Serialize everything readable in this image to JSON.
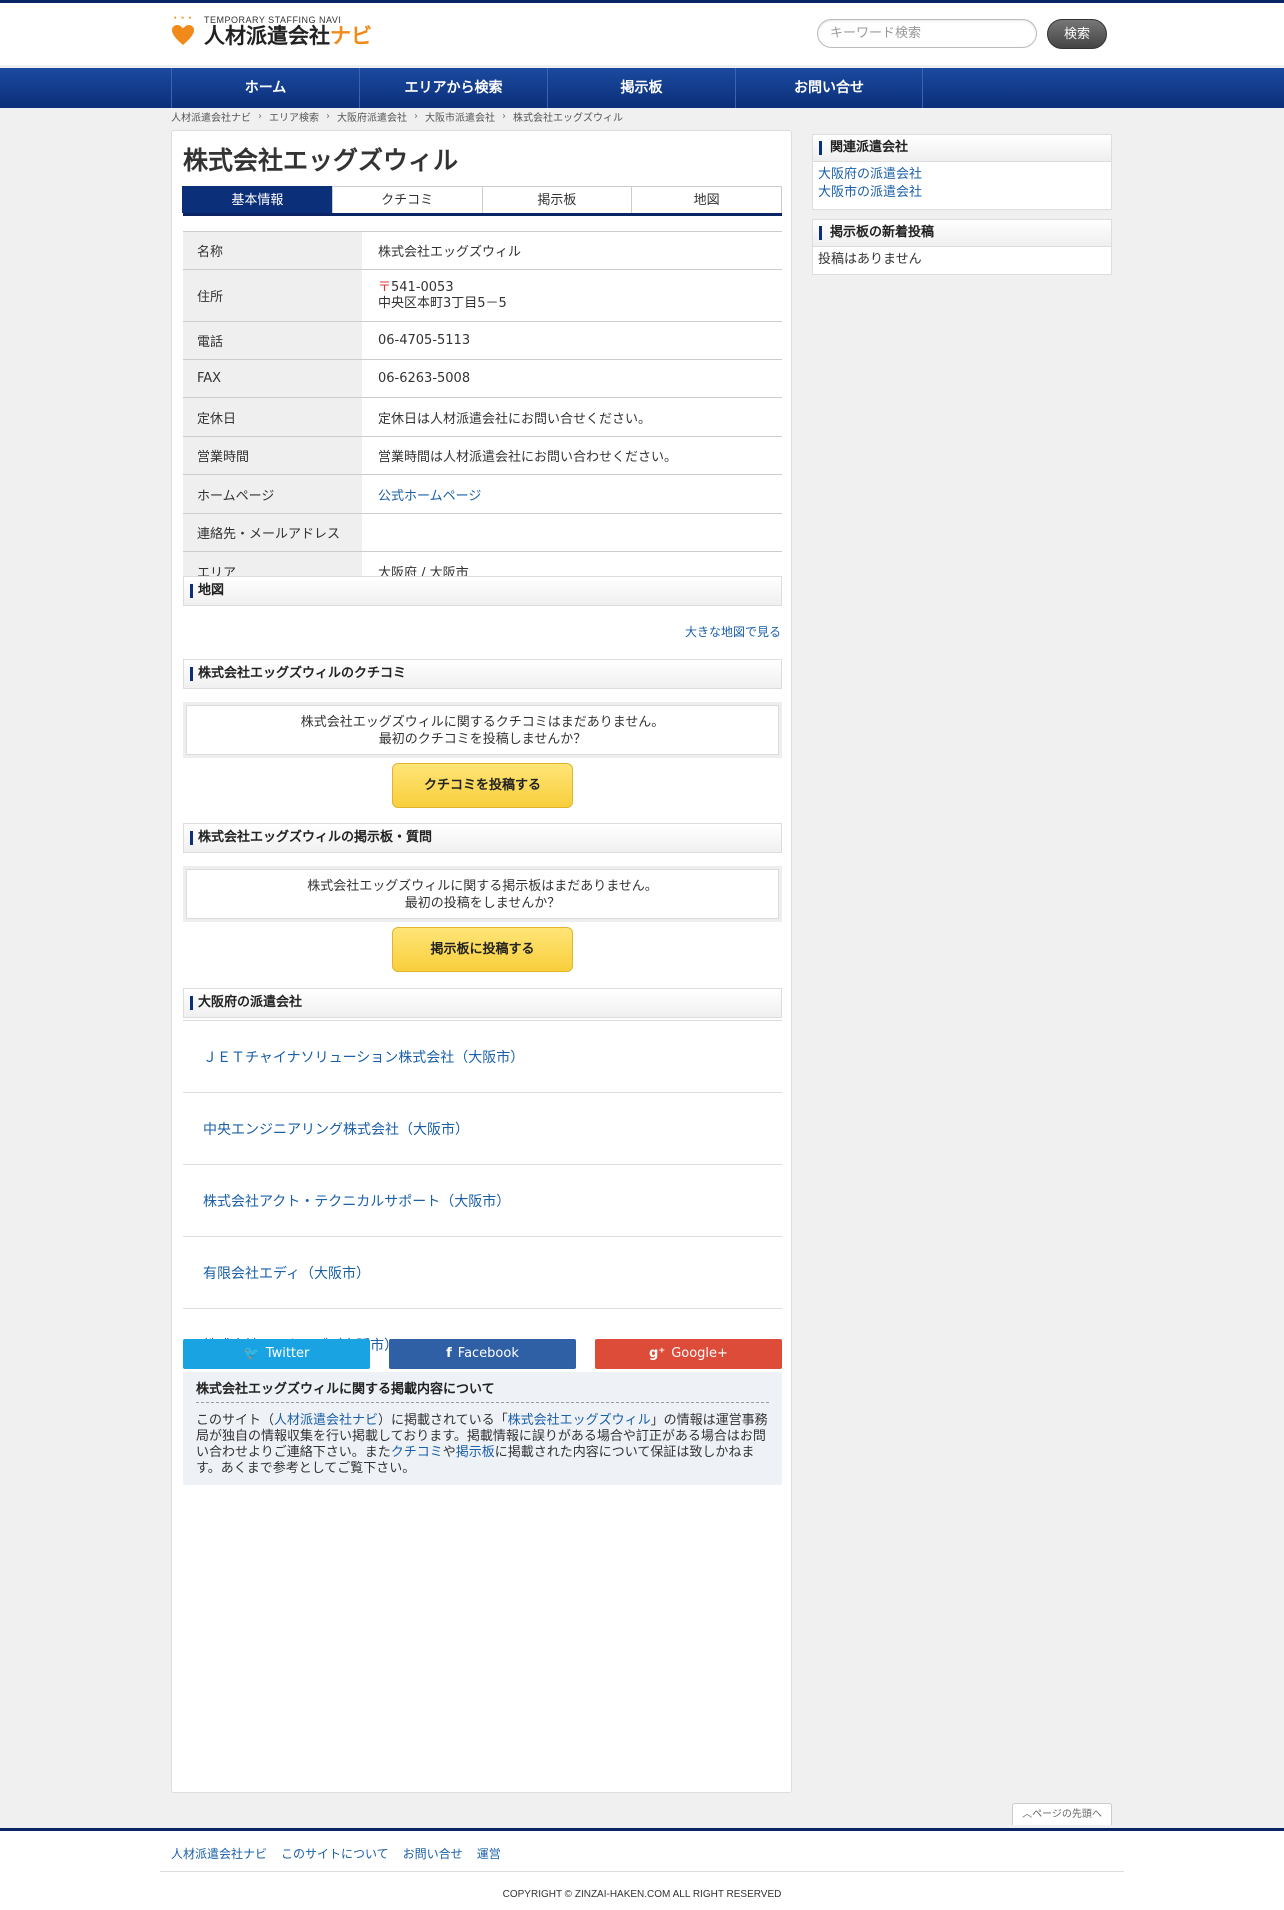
{
  "header": {
    "logo_sub": "TEMPORARY STAFFING NAVI",
    "logo_main": "人材派遣会社",
    "logo_accent": "ナビ",
    "search_placeholder": "キーワード検索",
    "search_button": "検索"
  },
  "nav": [
    "ホーム",
    "エリアから検索",
    "掲示板",
    "お問い合せ"
  ],
  "breadcrumb": [
    "人材派遣会社ナビ",
    "エリア検索",
    "大阪府派遣会社",
    "大阪市派遣会社",
    "株式会社エッグズウィル"
  ],
  "company": {
    "name": "株式会社エッグズウィル",
    "tabs": [
      "基本情報",
      "クチコミ",
      "掲示板",
      "地図"
    ],
    "info": {
      "name_label": "名称",
      "name_value": "株式会社エッグズウィル",
      "address_label": "住所",
      "postal": "〒541-0053",
      "address": "中央区本町3丁目5－5",
      "phone_label": "電話",
      "phone": "06-4705-5113",
      "fax_label": "FAX",
      "fax": "06-6263-5008",
      "holiday_label": "定休日",
      "holiday": "定休日は人材派遣会社にお問い合せください。",
      "hours_label": "営業時間",
      "hours": "営業時間は人材派遣会社にお問い合わせください。",
      "homepage_label": "ホームページ",
      "homepage": "公式ホームページ",
      "contact_label": "連絡先・メールアドレス",
      "contact": "",
      "area_label": "エリア",
      "area": "大阪府 / 大阪市"
    }
  },
  "map_section": {
    "title": "地図",
    "big_map_link": "大きな地図で見る"
  },
  "review_section": {
    "title": "株式会社エッグズウィルのクチコミ",
    "line1": "株式会社エッグズウィルに関するクチコミはまだありません。",
    "line2": "最初のクチコミを投稿しませんか？",
    "button": "クチコミを投稿する"
  },
  "board_section": {
    "title": "株式会社エッグズウィルの掲示板・質問",
    "line1": "株式会社エッグズウィルに関する掲示板はまだありません。",
    "line2": "最初の投稿をしませんか？",
    "button": "掲示板に投稿する"
  },
  "osaka_section": {
    "title": "大阪府の派遣会社",
    "companies": [
      "ＪＥＴチャイナソリューション株式会社（大阪市）",
      "中央エンジニアリング株式会社（大阪市）",
      "株式会社アクト・テクニカルサポート（大阪市）",
      "有限会社エディ（大阪市）",
      "株式会社アーカイブ（大阪市）"
    ]
  },
  "social": {
    "twitter": "Twitter",
    "facebook": "Facebook",
    "google": "Google+"
  },
  "about": {
    "title": "株式会社エッグズウィルに関する掲載内容について",
    "t1": "このサイト（",
    "link_site": "人材派遣会社ナビ",
    "t2": "）に掲載されている「",
    "link_company": "株式会社エッグズウィル",
    "t3": "」の情報は運営事務局が独自の情報収集を行い掲載しております。掲載情報に誤りがある場合や訂正がある場合はお問い合わせよりご連絡下さい。また",
    "link_review": "クチコミ",
    "t4": "や",
    "link_board": "掲示板",
    "t5": "に掲載された内容について保証は致しかねます。あくまで参考としてご覧下さい。"
  },
  "sidebar": {
    "related_title": "関連派遣会社",
    "related_links": [
      "大阪府の派遣会社",
      "大阪市の派遣会社"
    ],
    "board_title": "掲示板の新着投稿",
    "board_empty": "投稿はありません"
  },
  "pagetop": "ページの先頭へ",
  "footer": {
    "links": [
      "人材派遣会社ナビ",
      "このサイトについて",
      "お問い合せ",
      "運営"
    ],
    "copyright": "COPYRIGHT © ZINZAI-HAKEN.COM ALL RIGHT RESERVED"
  },
  "colors": {
    "navy": "#0b2f78",
    "orange": "#f08a1a",
    "twitter": "#1aa3e3",
    "facebook": "#2f5fa5",
    "google": "#dd4b39",
    "yellow": "#f8cf3c"
  }
}
